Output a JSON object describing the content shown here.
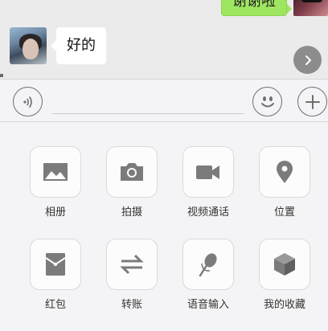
{
  "chat": {
    "outgoing_message": "谢谢啦",
    "incoming_message": "好的"
  },
  "panel": {
    "items": [
      {
        "label": "相册",
        "icon": "photo-album-icon"
      },
      {
        "label": "拍摄",
        "icon": "camera-icon"
      },
      {
        "label": "视频通话",
        "icon": "video-call-icon"
      },
      {
        "label": "位置",
        "icon": "location-pin-icon"
      },
      {
        "label": "红包",
        "icon": "red-packet-icon"
      },
      {
        "label": "转账",
        "icon": "transfer-icon"
      },
      {
        "label": "语音输入",
        "icon": "microphone-icon"
      },
      {
        "label": "我的收藏",
        "icon": "favorites-box-icon"
      }
    ]
  },
  "colors": {
    "outgoing_bubble": "#9fe660",
    "icon_gray": "#7b7b7b",
    "panel_bg": "#f4f4f6"
  }
}
